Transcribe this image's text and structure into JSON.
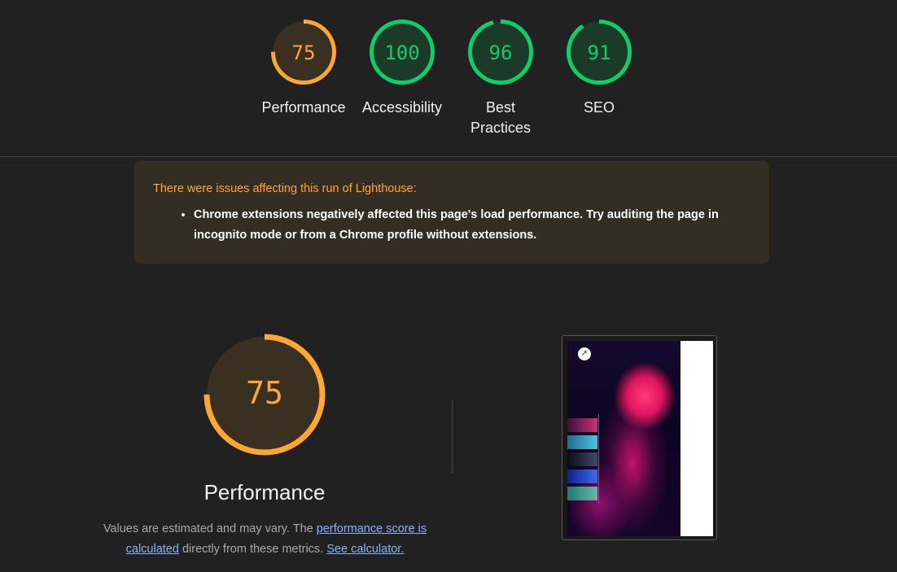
{
  "summary": {
    "gauges": [
      {
        "score": 75,
        "label": "Performance",
        "status": "average"
      },
      {
        "score": 100,
        "label": "Accessibility",
        "status": "pass"
      },
      {
        "score": 96,
        "label": "Best Practices",
        "status": "pass"
      },
      {
        "score": 91,
        "label": "SEO",
        "status": "pass"
      }
    ]
  },
  "warning": {
    "title": "There were issues affecting this run of Lighthouse:",
    "items": [
      "Chrome extensions negatively affected this page's load performance. Try auditing the page in incognito mode or from a Chrome profile without extensions."
    ]
  },
  "performance": {
    "score": 75,
    "title": "Performance",
    "desc_prefix": "Values are estimated and may vary. The ",
    "link_score": "performance score is calculated",
    "desc_middle": " directly from these metrics. ",
    "link_calculator": "See calculator."
  },
  "screenshot": {
    "icon": "compass-icon",
    "thumbnail_count": 5
  },
  "colors": {
    "background": "#212121",
    "average": "#ffa733",
    "average_bg": "#3a3022",
    "pass": "#0cce6b",
    "pass_bg": "#1b3a28",
    "warning_bg": "#332d24",
    "warning_text": "#ffa733",
    "link": "#8ab4f8"
  }
}
